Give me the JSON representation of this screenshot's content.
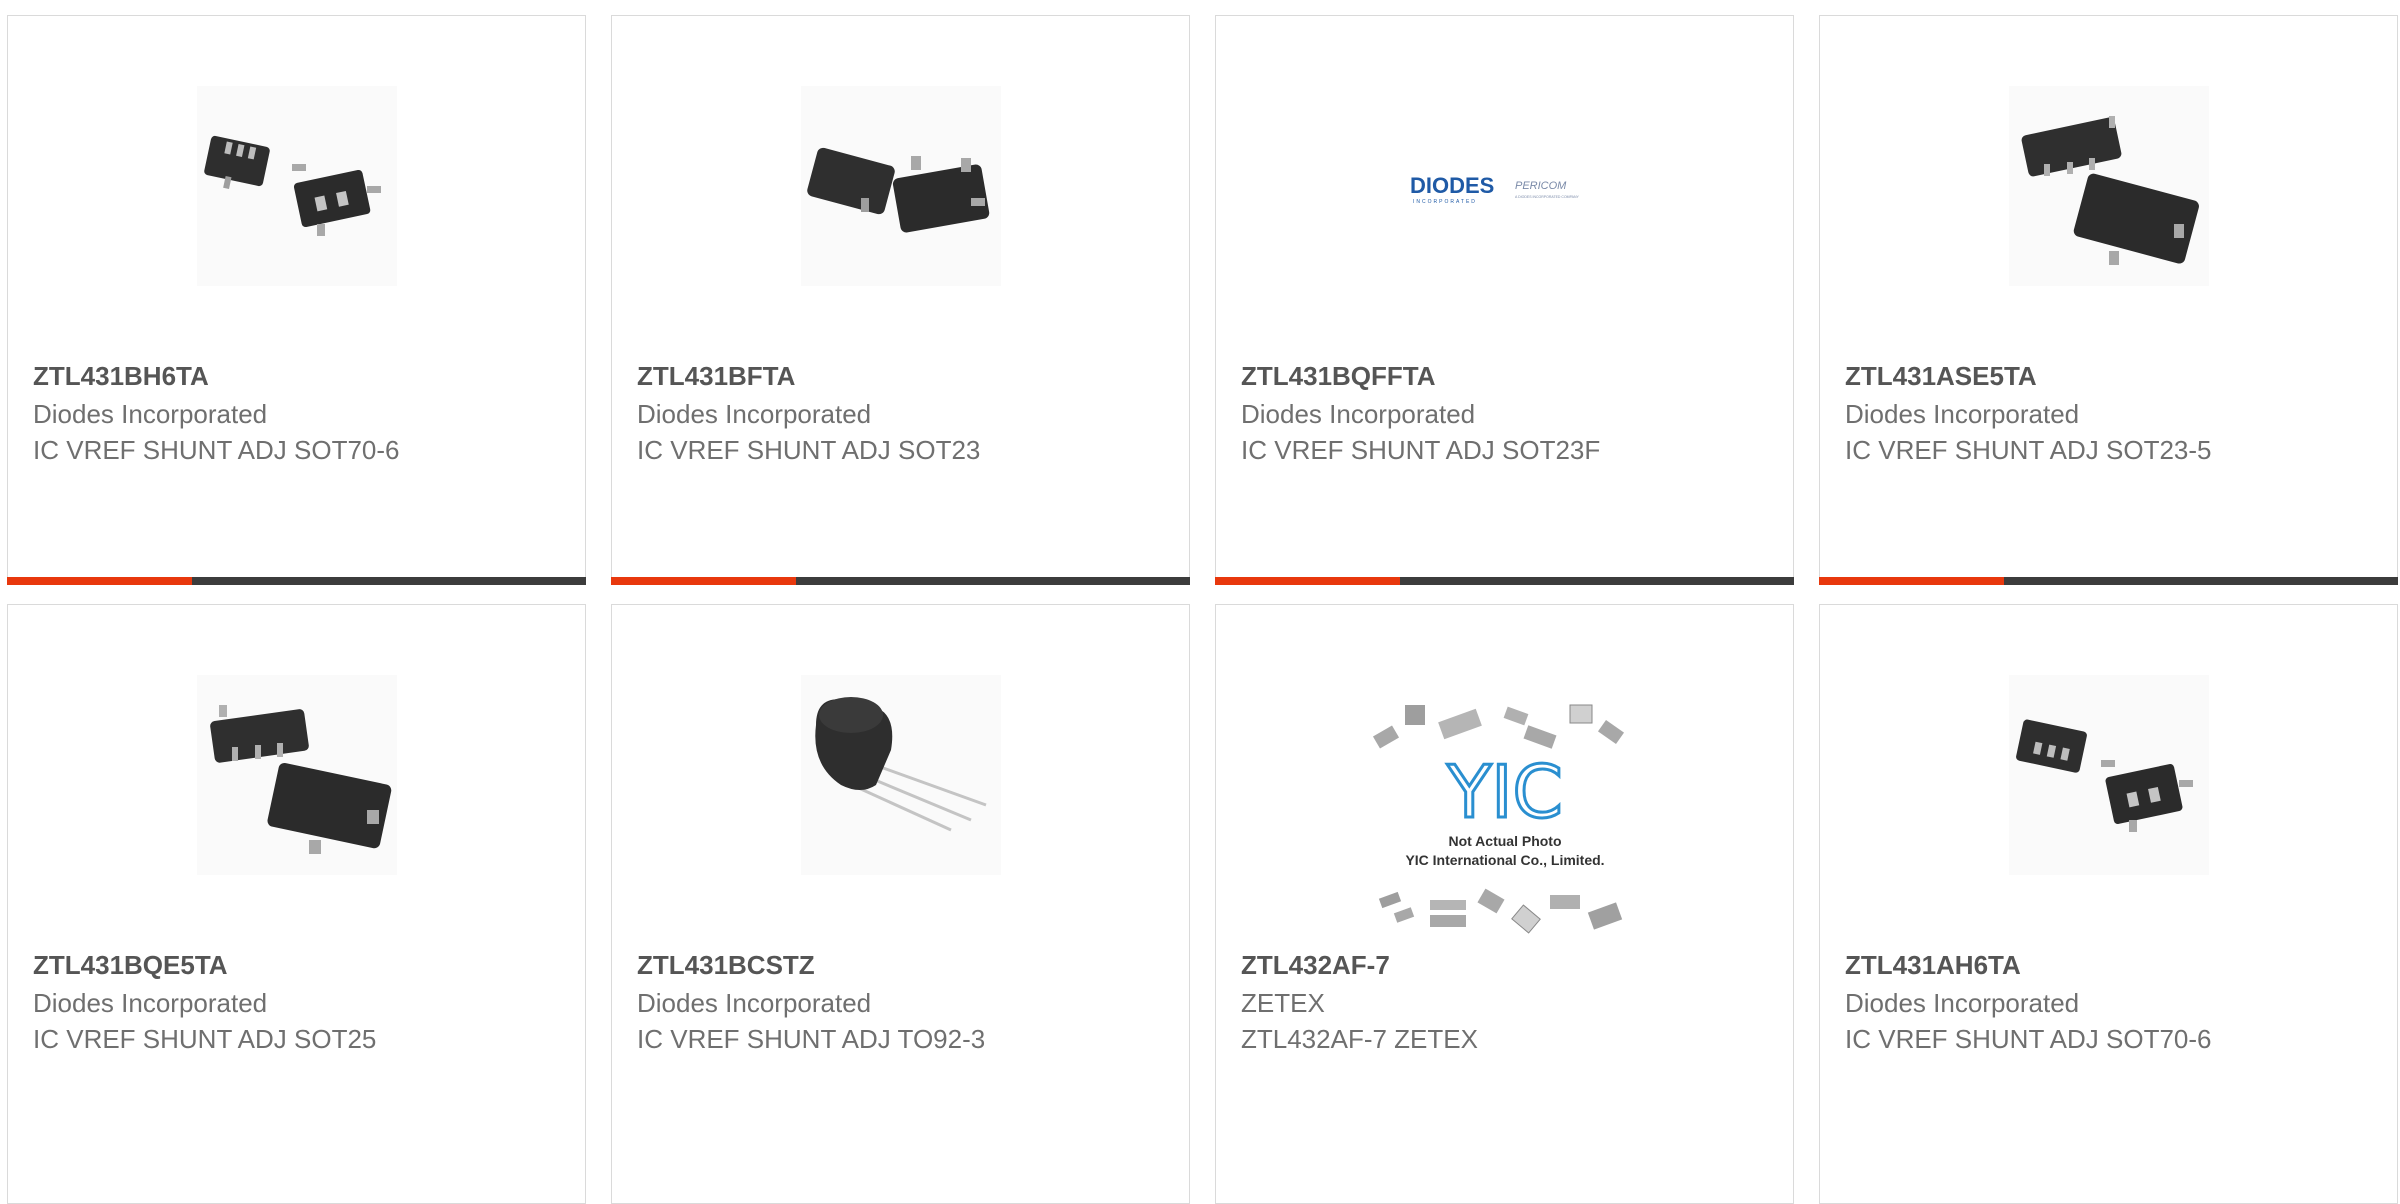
{
  "products": [
    {
      "part_number": "ZTL431BH6TA",
      "manufacturer": "Diodes Incorporated",
      "description": "IC VREF SHUNT ADJ SOT70-6",
      "image": "sot70-6-package-icon",
      "bar_fill_percent": 32
    },
    {
      "part_number": "ZTL431BFTA",
      "manufacturer": "Diodes Incorporated",
      "description": "IC VREF SHUNT ADJ SOT23",
      "image": "sot23-package-icon",
      "bar_fill_percent": 32
    },
    {
      "part_number": "ZTL431BQFFTA",
      "manufacturer": "Diodes Incorporated",
      "description": "IC VREF SHUNT ADJ SOT23F",
      "image": "diodes-pericom-logo",
      "bar_fill_percent": 32
    },
    {
      "part_number": "ZTL431ASE5TA",
      "manufacturer": "Diodes Incorporated",
      "description": "IC VREF SHUNT ADJ SOT23-5",
      "image": "sot23-5-package-icon",
      "bar_fill_percent": 32
    },
    {
      "part_number": "ZTL431BQE5TA",
      "manufacturer": "Diodes Incorporated",
      "description": "IC VREF SHUNT ADJ SOT25",
      "image": "sot25-package-icon"
    },
    {
      "part_number": "ZTL431BCSTZ",
      "manufacturer": "Diodes Incorporated",
      "description": "IC VREF SHUNT ADJ TO92-3",
      "image": "to92-3-package-icon"
    },
    {
      "part_number": "ZTL432AF-7",
      "manufacturer": "ZETEX",
      "description": "ZTL432AF-7 ZETEX",
      "image": "yic-placeholder-image"
    },
    {
      "part_number": "ZTL431AH6TA",
      "manufacturer": "Diodes Incorporated",
      "description": "IC VREF SHUNT ADJ SOT70-6",
      "image": "sot70-6-package-icon"
    }
  ],
  "images": {
    "diodes_logo": {
      "brand": "DIODES",
      "tagline": "INCORPORATED",
      "partner": "PERICOM",
      "partner_tagline": "A DIODES INCORPORATED COMPANY"
    },
    "yic_placeholder": {
      "logo": "YIC",
      "caption_1": "Not Actual Photo",
      "caption_2": "YIC International Co., Limited."
    }
  },
  "colors": {
    "accent": "#e8380d",
    "bar_track": "#3c3c3c",
    "card_border": "#dadada",
    "part_number": "#555555",
    "secondary_text": "#6f6f6f",
    "diodes_blue": "#1f5aa6",
    "yic_blue": "#2a8fd0"
  }
}
